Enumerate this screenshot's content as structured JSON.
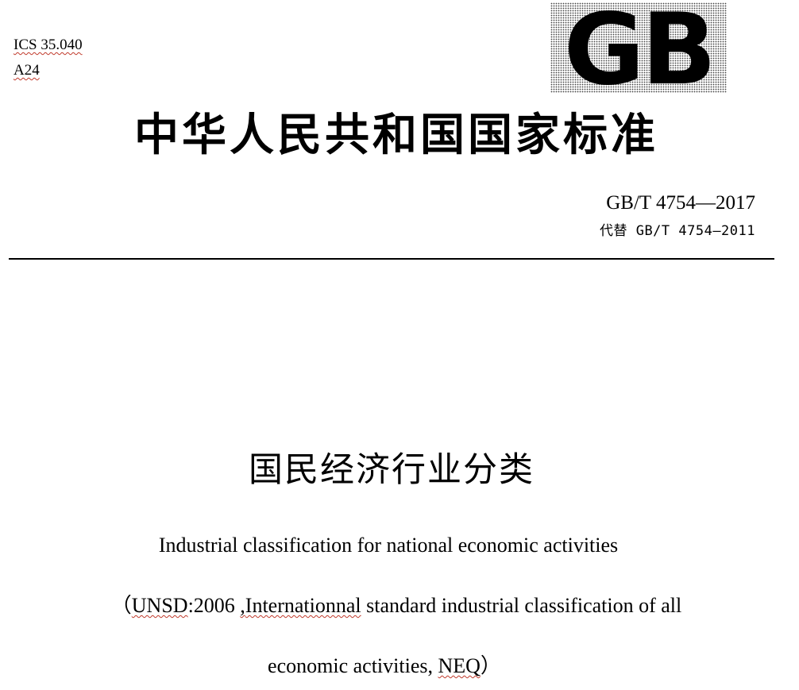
{
  "header": {
    "ics": "ICS 35.040",
    "category": "A24",
    "logo_text": "GB"
  },
  "national_title": "中华人民共和国国家标准",
  "standard": {
    "number": "GB/T 4754—2017",
    "replaces": "代替 GB/T 4754—2011"
  },
  "title": {
    "chinese": "国民经济行业分类",
    "english": "Industrial classification for national economic activities",
    "reference": {
      "open_paren": "（",
      "unsd": "UNSD",
      "year": ":2006 ",
      "comma": ",",
      "internationnal": "Internationnal",
      "line1_rest": " standard industrial classification of all",
      "line2_start": "economic activities, ",
      "neq": "NEQ",
      "close_paren": "）"
    }
  },
  "colors": {
    "text": "#000000",
    "spellcheck_underline": "#c0392b",
    "background": "#ffffff"
  }
}
